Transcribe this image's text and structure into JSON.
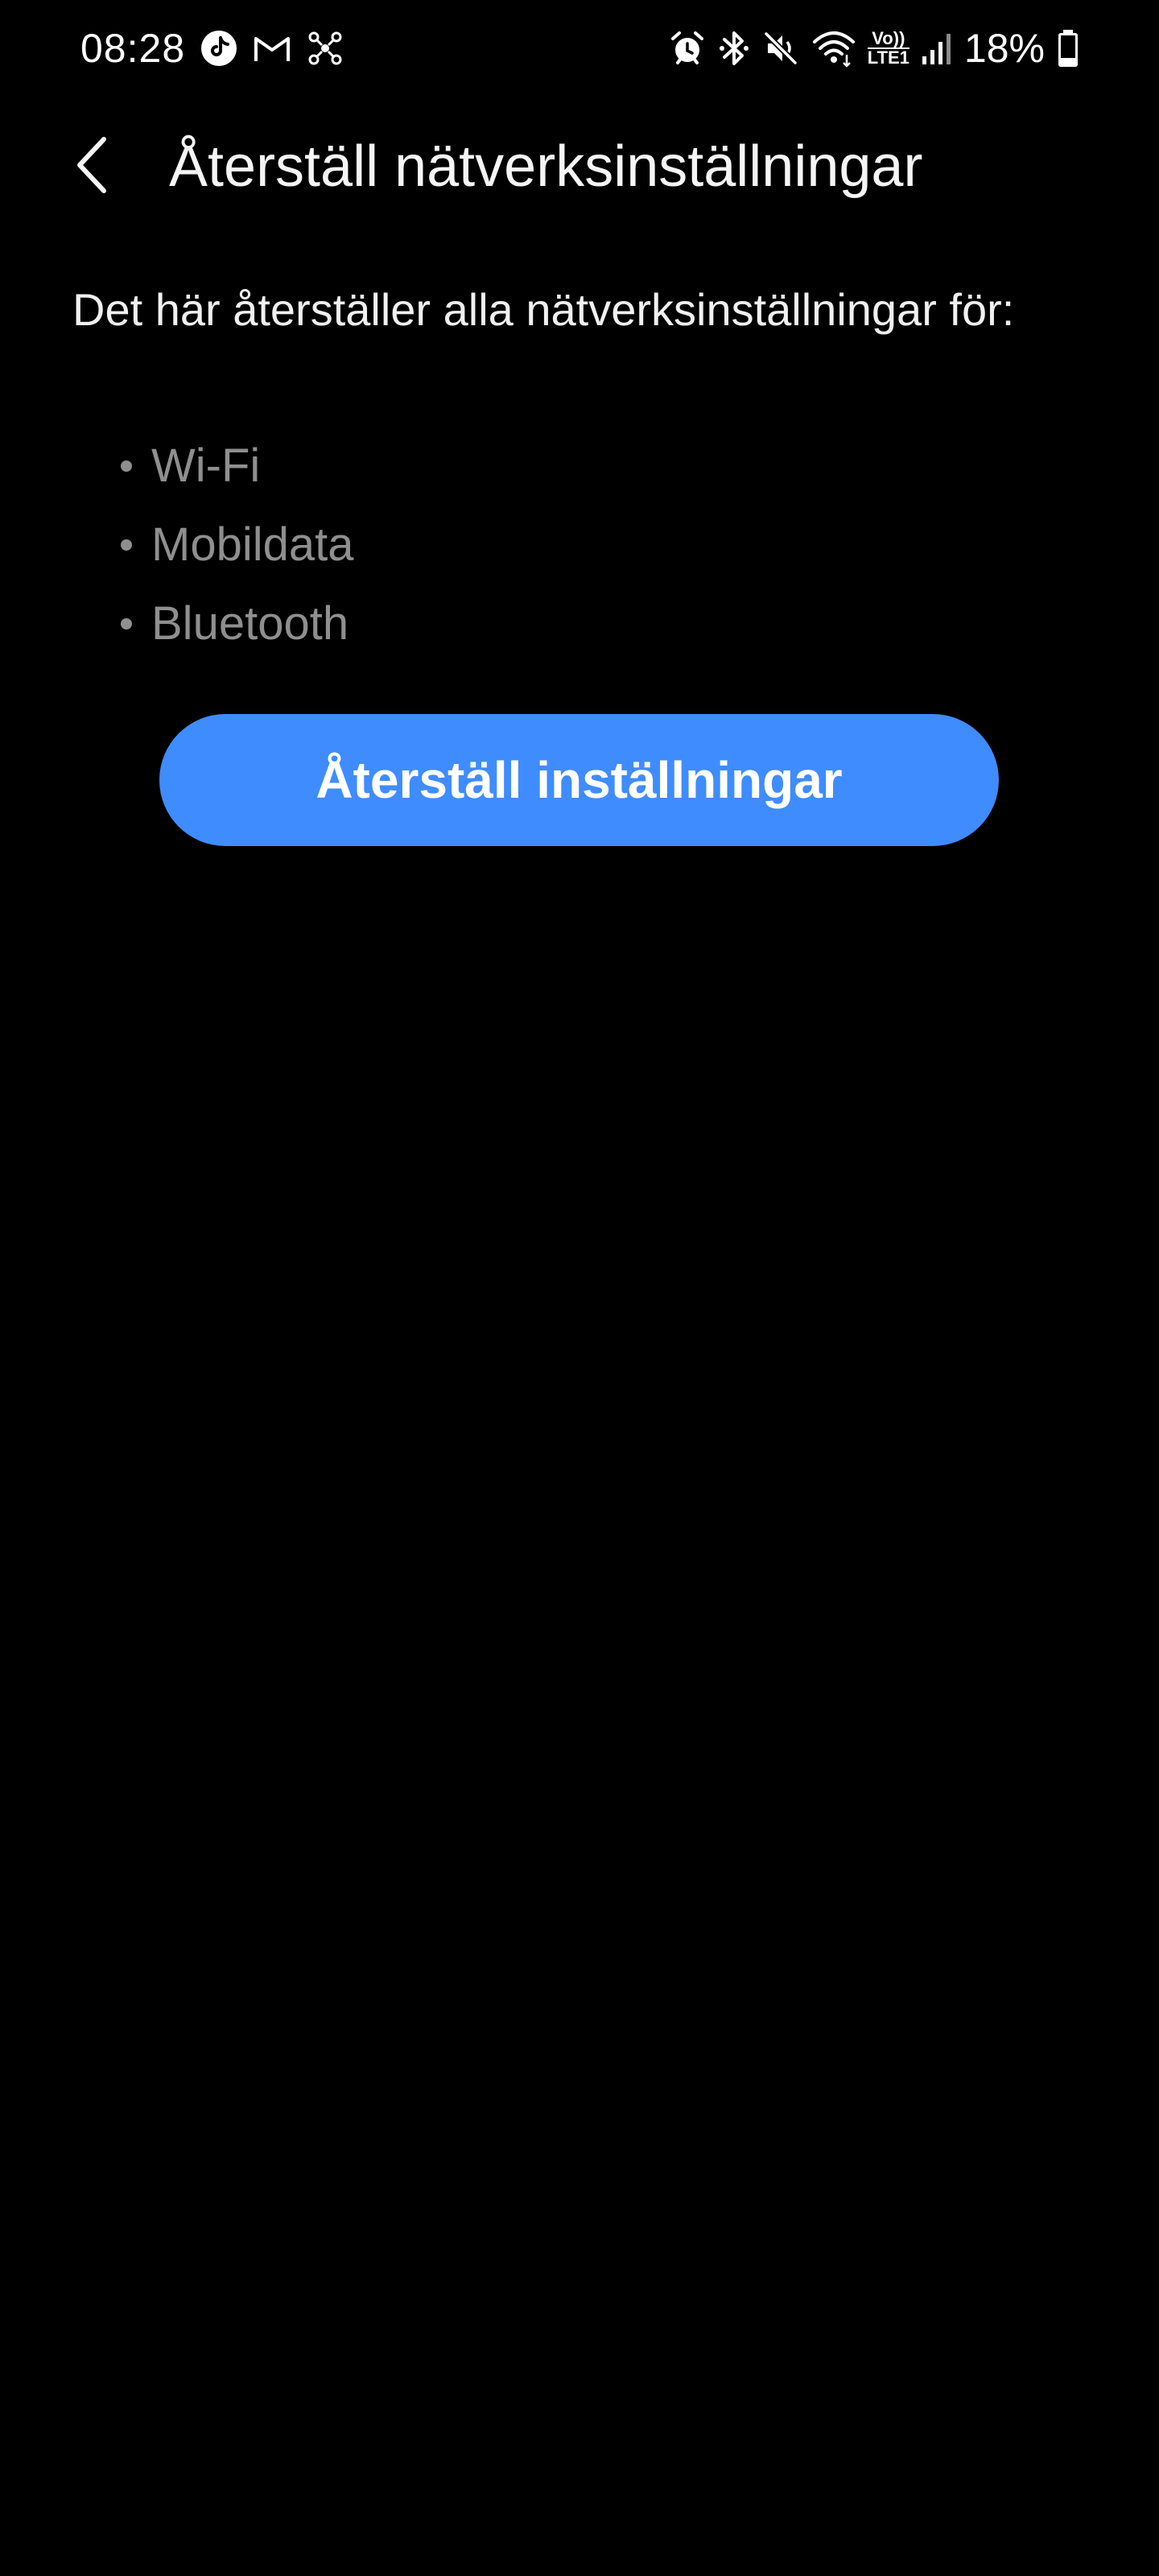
{
  "status_bar": {
    "time": "08:28",
    "left_icons": [
      "tiktok-notification-icon",
      "gmail-icon",
      "network-hub-icon"
    ],
    "right_icons": [
      "alarm-icon",
      "bluetooth-icon",
      "mute-icon",
      "wifi-icon",
      "volte-lte-icon",
      "signal-icon",
      "battery-icon"
    ],
    "volte_label": "Vo))",
    "lte_label": "LTE1",
    "battery_percent": "18%"
  },
  "header": {
    "title": "Återställ nätverksinställningar"
  },
  "content": {
    "description": "Det här återställer alla nätverksinställningar för:",
    "items": [
      {
        "label": "Wi-Fi"
      },
      {
        "label": "Mobildata"
      },
      {
        "label": "Bluetooth"
      }
    ],
    "reset_button_label": "Återställ inställningar"
  },
  "colors": {
    "background": "#000000",
    "accent": "#3f8cff",
    "secondary_text": "#8f8f8f"
  }
}
